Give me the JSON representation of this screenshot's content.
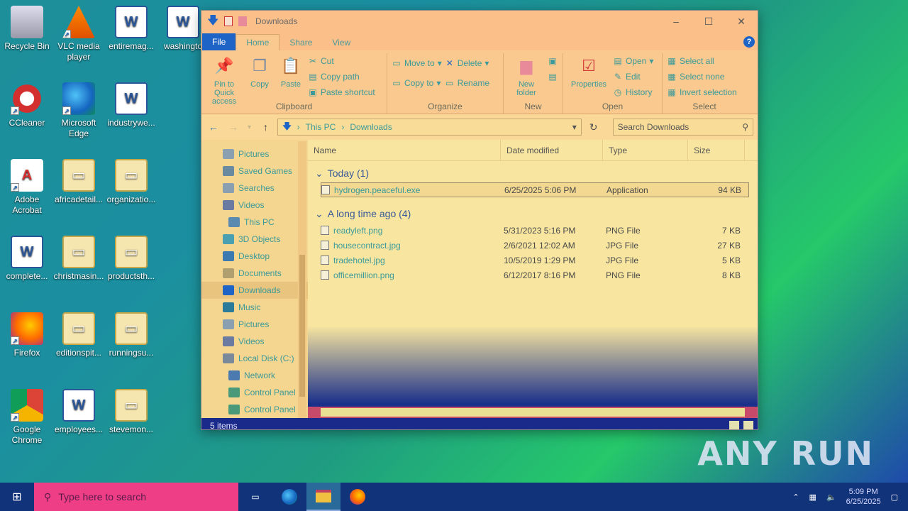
{
  "desktop": {
    "icons": [
      {
        "label": "Recycle Bin",
        "icon": "recycle-bin-icon"
      },
      {
        "label": "VLC media player",
        "icon": "vlc-icon"
      },
      {
        "label": "entiremag...",
        "icon": "word-doc-icon"
      },
      {
        "label": "washingto",
        "icon": "word-doc-icon"
      },
      {
        "label": "CCleaner",
        "icon": "ccleaner-icon"
      },
      {
        "label": "Microsoft Edge",
        "icon": "edge-icon"
      },
      {
        "label": "industrywe...",
        "icon": "word-doc-icon"
      },
      {
        "label": "Adobe Acrobat",
        "icon": "acrobat-icon"
      },
      {
        "label": "africadetail...",
        "icon": "image-file-icon"
      },
      {
        "label": "organizatio...",
        "icon": "image-file-icon"
      },
      {
        "label": "complete...",
        "icon": "word-doc-icon"
      },
      {
        "label": "christmasin...",
        "icon": "image-file-icon"
      },
      {
        "label": "productsth...",
        "icon": "image-file-icon"
      },
      {
        "label": "Firefox",
        "icon": "firefox-icon"
      },
      {
        "label": "editionspit...",
        "icon": "image-file-icon"
      },
      {
        "label": "runningsu...",
        "icon": "image-file-icon"
      },
      {
        "label": "Google Chrome",
        "icon": "chrome-icon"
      },
      {
        "label": "employees...",
        "icon": "word-doc-icon"
      },
      {
        "label": "stevemon...",
        "icon": "image-file-icon"
      }
    ]
  },
  "explorer": {
    "title": "Downloads",
    "tabs": {
      "file": "File",
      "home": "Home",
      "share": "Share",
      "view": "View"
    },
    "ribbon": {
      "clipboard": {
        "name": "Clipboard",
        "pin": "Pin to Quick access",
        "copy": "Copy",
        "paste": "Paste",
        "cut": "Cut",
        "copy_path": "Copy path",
        "paste_shortcut": "Paste shortcut"
      },
      "organize": {
        "name": "Organize",
        "move_to": "Move to",
        "copy_to": "Copy to",
        "delete": "Delete",
        "rename": "Rename"
      },
      "new": {
        "name": "New",
        "new_folder": "New folder"
      },
      "open": {
        "name": "Open",
        "properties": "Properties",
        "open": "Open",
        "edit": "Edit",
        "history": "History"
      },
      "select": {
        "name": "Select",
        "select_all": "Select all",
        "select_none": "Select none",
        "invert": "Invert selection"
      }
    },
    "address": {
      "crumb1": "This PC",
      "crumb2": "Downloads"
    },
    "search_placeholder": "Search Downloads",
    "nav": [
      {
        "label": "Pictures",
        "cls": "sub"
      },
      {
        "label": "Saved Games",
        "cls": "sub"
      },
      {
        "label": "Searches",
        "cls": "sub"
      },
      {
        "label": "Videos",
        "cls": "sub"
      },
      {
        "label": "This PC",
        "cls": ""
      },
      {
        "label": "3D Objects",
        "cls": "sub"
      },
      {
        "label": "Desktop",
        "cls": "sub"
      },
      {
        "label": "Documents",
        "cls": "sub"
      },
      {
        "label": "Downloads",
        "cls": "sub selected"
      },
      {
        "label": "Music",
        "cls": "sub"
      },
      {
        "label": "Pictures",
        "cls": "sub"
      },
      {
        "label": "Videos",
        "cls": "sub"
      },
      {
        "label": "Local Disk (C:)",
        "cls": "sub"
      },
      {
        "label": "Network",
        "cls": ""
      },
      {
        "label": "Control Panel",
        "cls": ""
      },
      {
        "label": "Control Panel",
        "cls": ""
      }
    ],
    "columns": {
      "name": "Name",
      "date": "Date modified",
      "type": "Type",
      "size": "Size"
    },
    "groups": [
      {
        "title": "Today (1)",
        "files": [
          {
            "name": "hydrogen.peaceful.exe",
            "date": "6/25/2025 5:06 PM",
            "type": "Application",
            "size": "94 KB",
            "selected": true
          }
        ]
      },
      {
        "title": "A long time ago (4)",
        "files": [
          {
            "name": "readyleft.png",
            "date": "5/31/2023 5:16 PM",
            "type": "PNG File",
            "size": "7 KB"
          },
          {
            "name": "housecontract.jpg",
            "date": "2/6/2021 12:02 AM",
            "type": "JPG File",
            "size": "27 KB"
          },
          {
            "name": "tradehotel.jpg",
            "date": "10/5/2019 1:29 PM",
            "type": "JPG File",
            "size": "5 KB"
          },
          {
            "name": "officemillion.png",
            "date": "6/12/2017 8:16 PM",
            "type": "PNG File",
            "size": "8 KB"
          }
        ]
      }
    ],
    "status": "5 items"
  },
  "taskbar": {
    "search_placeholder": "Type here to search",
    "time": "5:09 PM",
    "date": "6/25/2025"
  },
  "watermark": "ANY RUN"
}
